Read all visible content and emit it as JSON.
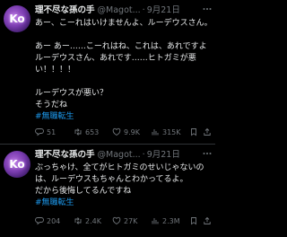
{
  "tweets": [
    {
      "author": {
        "name": "理不尽な孫の手",
        "handle": "@Magot...",
        "avatar_glyph": "Ko"
      },
      "separator": "·",
      "date": "9月21日",
      "more_icon": "more-horizontal-icon",
      "text_lines": [
        "あー、こーれはいけませんよ、ルーデウスさん。",
        "",
        "あー あー……こーれはね、これは、あれですよ",
        "ルーデウスさん、あれです……ヒトガミが悪",
        "い！！！！",
        "",
        "ルーデウスが悪い？",
        "そうだね"
      ],
      "hashtag": "#無職転生",
      "stats": {
        "replies": "51",
        "retweets": "653",
        "likes": "9.9K",
        "views": "315K"
      }
    },
    {
      "author": {
        "name": "理不尽な孫の手",
        "handle": "@Magot...",
        "avatar_glyph": "Ko"
      },
      "separator": "·",
      "date": "9月21日",
      "more_icon": "more-horizontal-icon",
      "text_lines": [
        "ぶっちゃけ、全てがヒトガミのせいじゃないの",
        "は、ルーデウスもちゃんとわかってるよ。",
        "だから後悔してるんですね"
      ],
      "hashtag": "#無職転生",
      "stats": {
        "replies": "204",
        "retweets": "2.4K",
        "likes": "27K",
        "views": "2.3M"
      }
    }
  ],
  "colors": {
    "background": "#000000",
    "text": "#e7e9ea",
    "muted": "#71767b",
    "link": "#1d9bf0",
    "divider": "#2f3336"
  },
  "icons": {
    "reply": "reply-icon",
    "retweet": "retweet-icon",
    "like": "heart-icon",
    "views": "views-chart-icon",
    "bookmark": "bookmark-icon",
    "share": "share-icon"
  }
}
